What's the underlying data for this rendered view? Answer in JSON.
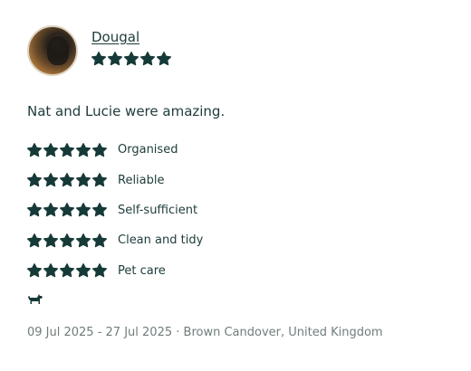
{
  "review": {
    "reviewer_name": "Dougal",
    "overall_rating": 5,
    "comment": "Nat and Lucie were amazing.",
    "ratings": [
      {
        "label": "Organised",
        "value": 5
      },
      {
        "label": "Reliable",
        "value": 5
      },
      {
        "label": "Self-sufficient",
        "value": 5
      },
      {
        "label": "Clean and tidy",
        "value": 5
      },
      {
        "label": "Pet care",
        "value": 5
      }
    ],
    "pet_icon": "dog-icon",
    "dates": "09 Jul 2025 - 27 Jul 2025",
    "separator": "·",
    "location": "Brown Candover, United Kingdom"
  },
  "colors": {
    "text": "#1d3b3a",
    "star": "#163a38",
    "muted": "#6f7d7c"
  }
}
